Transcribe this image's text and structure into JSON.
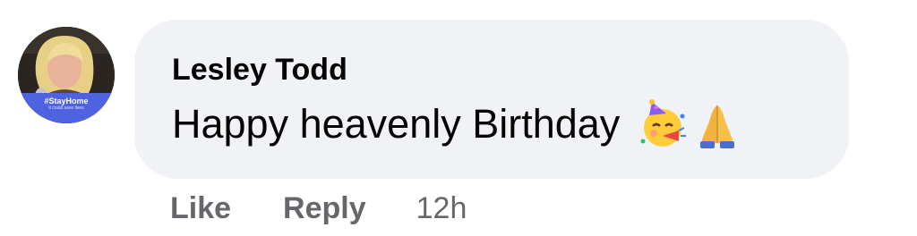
{
  "comment": {
    "author": "Lesley Todd",
    "text": "Happy heavenly Birthday",
    "emojis": [
      "partying-face-icon",
      "folded-hands-icon"
    ],
    "avatar": {
      "frame_tag": "#StayHome",
      "frame_subtext": "it could save lives"
    },
    "actions": {
      "like_label": "Like",
      "reply_label": "Reply",
      "timestamp": "12h"
    }
  },
  "colors": {
    "bubble_background": "#f0f2f5",
    "text": "#050505",
    "secondary_text": "#65676b",
    "frame_band": "#4f63e0"
  }
}
